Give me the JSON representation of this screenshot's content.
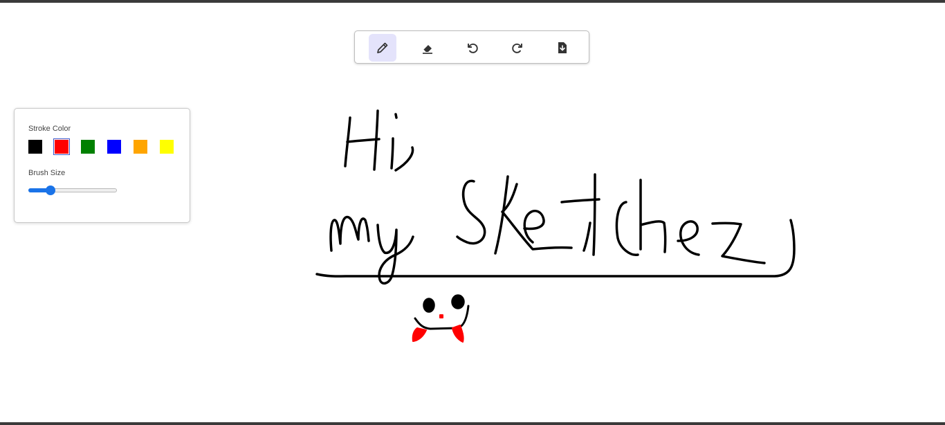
{
  "toolbar": {
    "tools": [
      {
        "name": "pencil",
        "icon": "pencil-icon",
        "active": true
      },
      {
        "name": "eraser",
        "icon": "eraser-icon",
        "active": false
      },
      {
        "name": "undo",
        "icon": "undo-icon",
        "active": false
      },
      {
        "name": "redo",
        "icon": "redo-icon",
        "active": false
      },
      {
        "name": "download",
        "icon": "file-download-icon",
        "active": false
      }
    ],
    "active_color": "#e4e3fb",
    "icon_color": "#333333"
  },
  "panel": {
    "stroke_color_label": "Stroke Color",
    "brush_size_label": "Brush Size",
    "colors": [
      "#000000",
      "#ff0000",
      "#008000",
      "#0000ff",
      "#ffa500",
      "#ffff00"
    ],
    "selected_color": "#ff0000",
    "brush_size_fraction": 0.25,
    "slider_accent": "#1a73e8"
  },
  "canvas": {
    "background": "#ffffff",
    "handwritten_text": [
      "Hi,",
      "my Sketchez"
    ]
  }
}
